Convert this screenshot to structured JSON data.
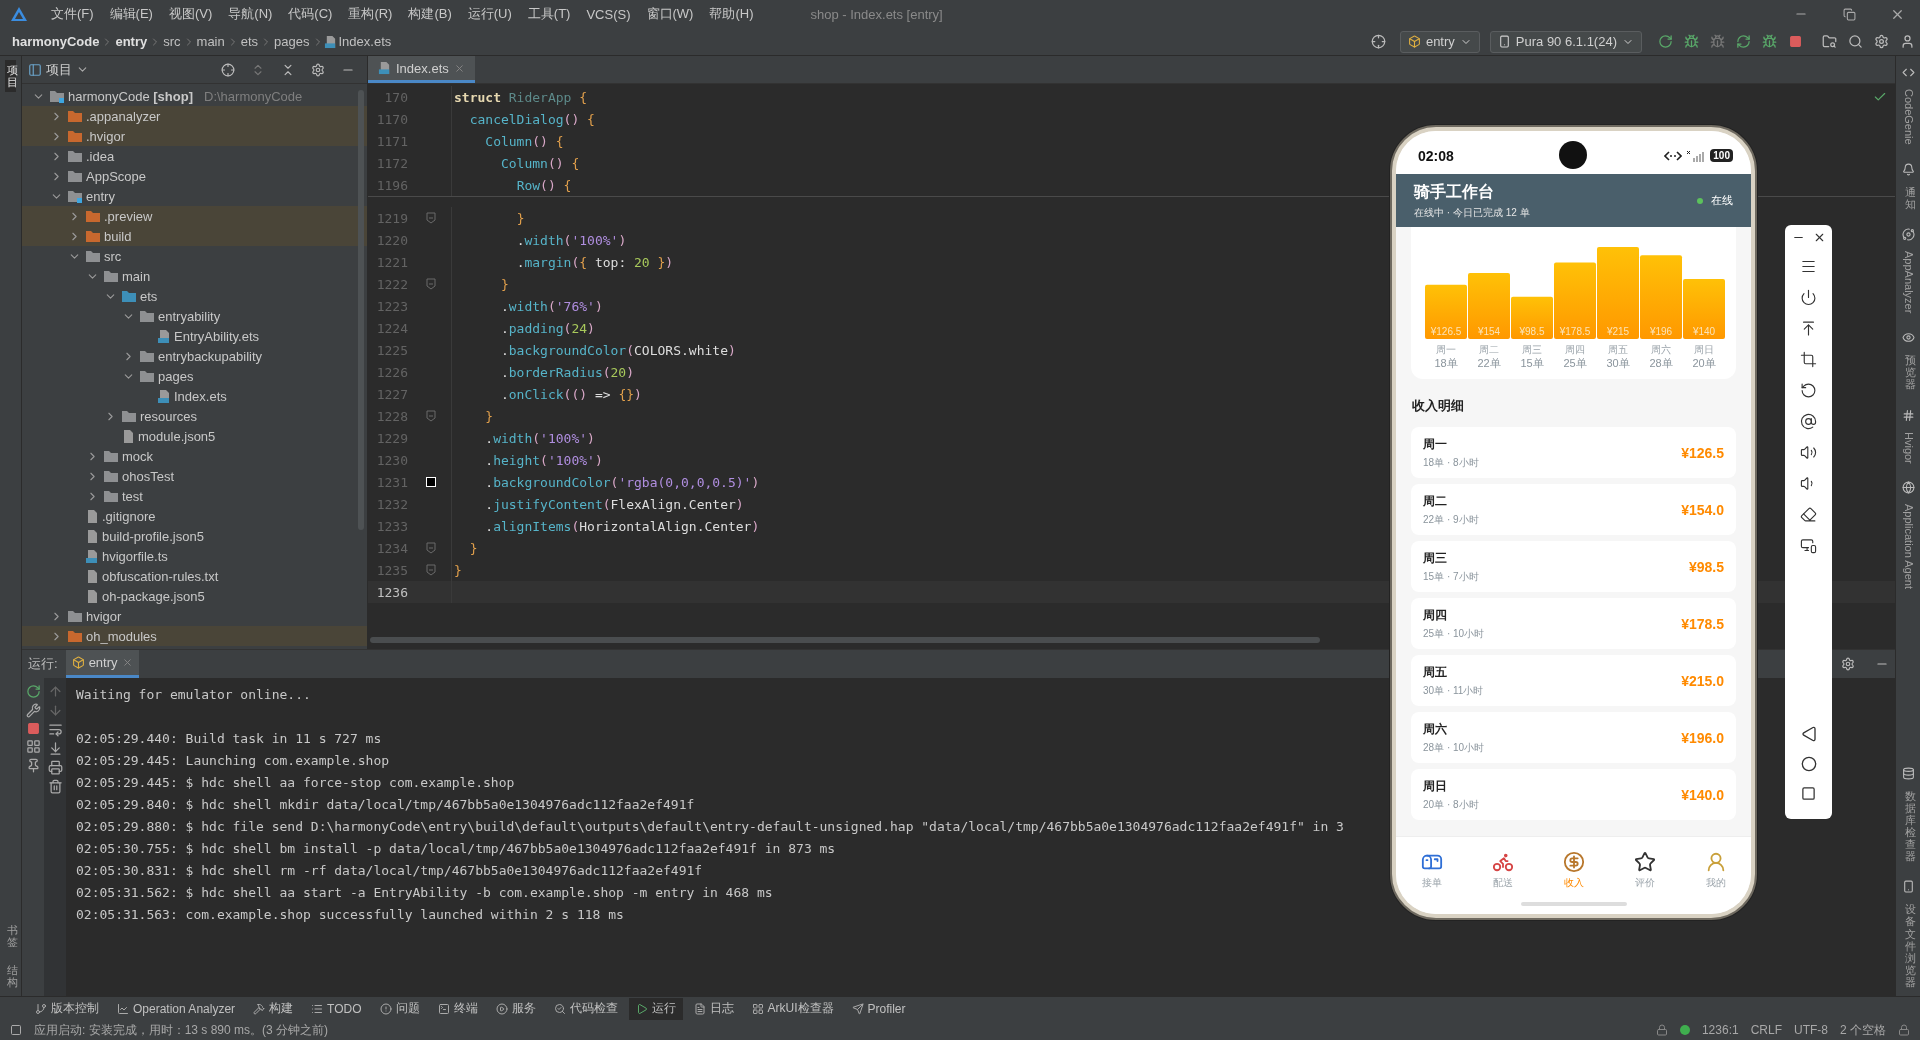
{
  "menu_bar": {
    "items": [
      "文件(F)",
      "编辑(E)",
      "视图(V)",
      "导航(N)",
      "代码(C)",
      "重构(R)",
      "构建(B)",
      "运行(U)",
      "工具(T)",
      "VCS(S)",
      "窗口(W)",
      "帮助(H)"
    ],
    "title": "shop - Index.ets [entry]"
  },
  "nav_bar": {
    "breadcrumbs": [
      "harmonyCode",
      "entry",
      "src",
      "main",
      "ets",
      "pages",
      "Index.ets"
    ],
    "run_config": "entry",
    "device": "Pura 90 6.1.1(24)"
  },
  "left_strip": [
    {
      "label": "项目",
      "selected": true
    },
    {
      "label": "书签",
      "selected": false
    },
    {
      "label": "结构",
      "selected": false
    }
  ],
  "project_panel": {
    "title": "项目",
    "tree": [
      {
        "label": "harmonyCode **[shop]**",
        "path": "D:\\harmonyCode",
        "kind": "module",
        "excluded": false,
        "expanded": true,
        "children": [
          {
            "label": ".appanalyzer",
            "kind": "folder",
            "excluded": true,
            "expanded": false
          },
          {
            "label": ".hvigor",
            "kind": "folder",
            "excluded": true,
            "expanded": false
          },
          {
            "label": ".idea",
            "kind": "folder",
            "excluded": false,
            "expanded": false
          },
          {
            "label": "AppScope",
            "kind": "folder",
            "excluded": false,
            "expanded": false
          },
          {
            "label": "entry",
            "kind": "module",
            "excluded": false,
            "expanded": true,
            "children": [
              {
                "label": ".preview",
                "kind": "folder",
                "excluded": true,
                "expanded": false
              },
              {
                "label": "build",
                "kind": "folder",
                "excluded": true,
                "expanded": false
              },
              {
                "label": "src",
                "kind": "folder",
                "excluded": false,
                "expanded": true,
                "children": [
                  {
                    "label": "main",
                    "kind": "folder",
                    "excluded": false,
                    "expanded": true,
                    "children": [
                      {
                        "label": "ets",
                        "kind": "source",
                        "excluded": false,
                        "expanded": true,
                        "children": [
                          {
                            "label": "entryability",
                            "kind": "folder",
                            "excluded": false,
                            "expanded": true,
                            "children": [
                              {
                                "label": "EntryAbility.ets",
                                "kind": "ets",
                                "excluded": false
                              }
                            ]
                          },
                          {
                            "label": "entrybackupability",
                            "kind": "folder",
                            "excluded": false,
                            "expanded": false
                          },
                          {
                            "label": "pages",
                            "kind": "folder",
                            "excluded": false,
                            "expanded": true,
                            "children": [
                              {
                                "label": "Index.ets",
                                "kind": "ets",
                                "excluded": false
                              }
                            ]
                          }
                        ]
                      },
                      {
                        "label": "resources",
                        "kind": "folder",
                        "excluded": false,
                        "expanded": false
                      },
                      {
                        "label": "module.json5",
                        "kind": "json5",
                        "excluded": false
                      }
                    ]
                  },
                  {
                    "label": "mock",
                    "kind": "folder",
                    "excluded": false,
                    "expanded": false
                  },
                  {
                    "label": "ohosTest",
                    "kind": "folder",
                    "excluded": false,
                    "expanded": false
                  },
                  {
                    "label": "test",
                    "kind": "folder",
                    "excluded": false,
                    "expanded": false
                  }
                ]
              },
              {
                "label": ".gitignore",
                "kind": "ignore",
                "excluded": false
              },
              {
                "label": "build-profile.json5",
                "kind": "json5",
                "excluded": false
              },
              {
                "label": "hvigorfile.ts",
                "kind": "ts",
                "excluded": false
              },
              {
                "label": "obfuscation-rules.txt",
                "kind": "txt",
                "excluded": false
              },
              {
                "label": "oh-package.json5",
                "kind": "json5",
                "excluded": false
              }
            ]
          },
          {
            "label": "hvigor",
            "kind": "folder",
            "excluded": false,
            "expanded": false
          },
          {
            "label": "oh_modules",
            "kind": "folder",
            "excluded": true,
            "expanded": false
          }
        ]
      }
    ]
  },
  "editor": {
    "tabs": [
      {
        "label": "Index.ets",
        "selected": true
      }
    ],
    "sticky_lines": [
      {
        "num": "170",
        "code": "struct RiderApp {"
      },
      {
        "num": "1170",
        "code": "  cancelDialog() {"
      },
      {
        "num": "1171",
        "code": "    Column() {"
      },
      {
        "num": "1172",
        "code": "      Column() {"
      },
      {
        "num": "1196",
        "code": "        Row() {"
      }
    ],
    "lines": [
      {
        "num": "1219",
        "code": "        }",
        "kind": "fold",
        "current": false
      },
      {
        "num": "1220",
        "code": "        .width('100%')",
        "kind": "plain",
        "current": false
      },
      {
        "num": "1221",
        "code": "        .margin({ top: 20 })",
        "kind": "plain",
        "current": false
      },
      {
        "num": "1222",
        "code": "      }",
        "kind": "fold",
        "current": false
      },
      {
        "num": "1223",
        "code": "      .width('76%')",
        "kind": "plain",
        "current": false
      },
      {
        "num": "1224",
        "code": "      .padding(24)",
        "kind": "plain",
        "current": false
      },
      {
        "num": "1225",
        "code": "      .backgroundColor(COLORS.white)",
        "kind": "plain",
        "current": false
      },
      {
        "num": "1226",
        "code": "      .borderRadius(20)",
        "kind": "plain",
        "current": false
      },
      {
        "num": "1227",
        "code": "      .onClick(() => {})",
        "kind": "plain",
        "current": false
      },
      {
        "num": "1228",
        "code": "    }",
        "kind": "fold",
        "current": false
      },
      {
        "num": "1229",
        "code": "    .width('100%')",
        "kind": "plain",
        "current": false
      },
      {
        "num": "1230",
        "code": "    .height('100%')",
        "kind": "plain",
        "current": false
      },
      {
        "num": "1231",
        "code": "    .backgroundColor('rgba(0,0,0,0.5)')",
        "kind": "swatch",
        "current": false
      },
      {
        "num": "1232",
        "code": "    .justifyContent(FlexAlign.Center)",
        "kind": "plain",
        "current": false
      },
      {
        "num": "1233",
        "code": "    .alignItems(HorizontalAlign.Center)",
        "kind": "plain",
        "current": false
      },
      {
        "num": "1234",
        "code": "  }",
        "kind": "fold",
        "current": false
      },
      {
        "num": "1235",
        "code": "}",
        "kind": "fold",
        "current": false
      },
      {
        "num": "1236",
        "kind": "plain",
        "current": true
      }
    ]
  },
  "emulator": {
    "time": "02:08",
    "battery": "100",
    "header": {
      "title": "骑手工作台",
      "subtitle": "在线中 · 今日已完成 12 单",
      "status": "在线",
      "online": true
    },
    "chart": {
      "chart_data": {
        "type": "bar",
        "categories": [
          "周一",
          "周二",
          "周三",
          "周四",
          "周五",
          "周六",
          "周日"
        ],
        "values": [
          126.5,
          154,
          98.5,
          178.5,
          215,
          196,
          140
        ],
        "ylim": [
          0,
          215
        ],
        "value_labels": [
          "¥126.5",
          "¥154",
          "¥98.5",
          "¥178.5",
          "¥215",
          "¥196",
          "¥140"
        ]
      },
      "notes": [
        "18单",
        "22单",
        "15单",
        "25单",
        "30单",
        "28单",
        "20单"
      ]
    },
    "section_title": "收入明细",
    "rows": [
      {
        "day": "周一",
        "detail": "18单 · 8小时",
        "amount": "¥126.5"
      },
      {
        "day": "周二",
        "detail": "22单 · 9小时",
        "amount": "¥154.0"
      },
      {
        "day": "周三",
        "detail": "15单 · 7小时",
        "amount": "¥98.5"
      },
      {
        "day": "周四",
        "detail": "25单 · 10小时",
        "amount": "¥178.5"
      },
      {
        "day": "周五",
        "detail": "30单 · 11小时",
        "amount": "¥215.0"
      },
      {
        "day": "周六",
        "detail": "28单 · 10小时",
        "amount": "¥196.0"
      },
      {
        "day": "周日",
        "detail": "20单 · 8小时",
        "amount": "¥140.0"
      }
    ],
    "nav": [
      {
        "label": "接单",
        "selected": false
      },
      {
        "label": "配送",
        "selected": false
      },
      {
        "label": "收入",
        "selected": true
      },
      {
        "label": "评价",
        "selected": false
      },
      {
        "label": "我的",
        "selected": false
      }
    ]
  },
  "run_panel": {
    "label": "运行:",
    "tabs": [
      {
        "label": "entry",
        "selected": true
      }
    ],
    "console": [
      [
        "Waiting for emulator online..."
      ],
      [
        "02:05:29.440: Build task in 11 s 727 ms",
        "02:05:29.445: Launching com.example.shop",
        "02:05:29.445: $ hdc shell aa force-stop com.example.shop",
        "02:05:29.840: $ hdc shell mkdir data/local/tmp/467bb5a0e1304976adc112faa2ef491f",
        "02:05:29.880: $ hdc file send D:\\harmonyCode\\entry\\build\\default\\outputs\\default\\entry-default-unsigned.hap \"data/local/tmp/467bb5a0e1304976adc112faa2ef491f\" in 3",
        "02:05:30.755: $ hdc shell bm install -p data/local/tmp/467bb5a0e1304976adc112faa2ef491f in 873 ms",
        "02:05:30.831: $ hdc shell rm -rf data/local/tmp/467bb5a0e1304976adc112faa2ef491f",
        "02:05:31.562: $ hdc shell aa start -a EntryAbility -b com.example.shop -m entry in 468 ms",
        "02:05:31.563: com.example.shop successfully launched within 2 s 118 ms"
      ]
    ]
  },
  "tool_tabs": [
    {
      "label": "版本控制",
      "selected": false
    },
    {
      "label": "Operation Analyzer",
      "selected": false
    },
    {
      "label": "构建",
      "selected": false
    },
    {
      "label": "TODO",
      "selected": false
    },
    {
      "label": "问题",
      "selected": false
    },
    {
      "label": "终端",
      "selected": false
    },
    {
      "label": "服务",
      "selected": false
    },
    {
      "label": "代码检查",
      "selected": false
    },
    {
      "label": "运行",
      "selected": true
    },
    {
      "label": "日志",
      "selected": false
    },
    {
      "label": "ArkUI检查器",
      "selected": false
    },
    {
      "label": "Profiler",
      "selected": false
    }
  ],
  "status_bar": {
    "message": "应用启动: 安装完成，用时：13 s 890 ms。(3 分钟之前)",
    "items": [
      "1236:1",
      "CRLF",
      "UTF-8",
      "2 个空格"
    ]
  },
  "right_strip": [
    "CodeGenie",
    "通知",
    "AppAnalyzer",
    "预览器",
    "Hvigor",
    "Application Agent",
    "数据库检查器",
    "设备文件浏览器"
  ]
}
